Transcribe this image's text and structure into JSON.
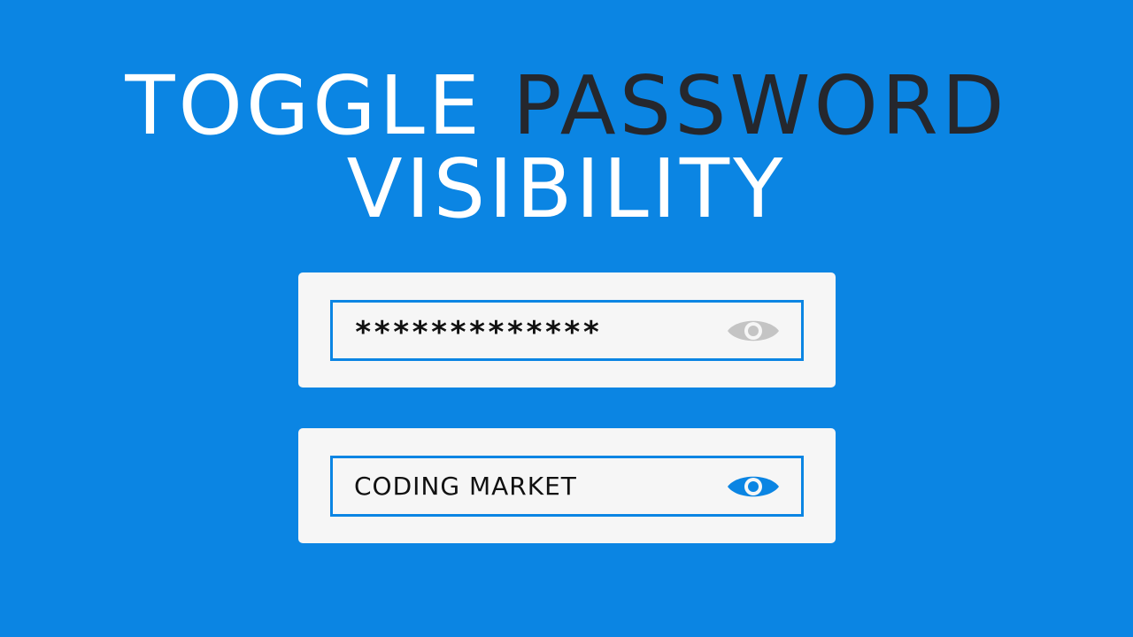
{
  "headline": {
    "word_toggle": "TOGGLE",
    "word_password": "PASSWORD",
    "word_visibility": "VISIBILITY"
  },
  "fields": [
    {
      "value": "*************",
      "state": "hidden",
      "eye_icon": "eye-icon",
      "eye_color": "#c4c4c4"
    },
    {
      "value": "CODING MARKET",
      "state": "visible",
      "eye_icon": "eye-icon",
      "eye_color": "#0b85e3"
    }
  ],
  "colors": {
    "background": "#0b85e3",
    "card": "#f6f6f6",
    "field_border": "#0b85e3",
    "headline_white": "#ffffff",
    "headline_dark": "#25272d"
  }
}
